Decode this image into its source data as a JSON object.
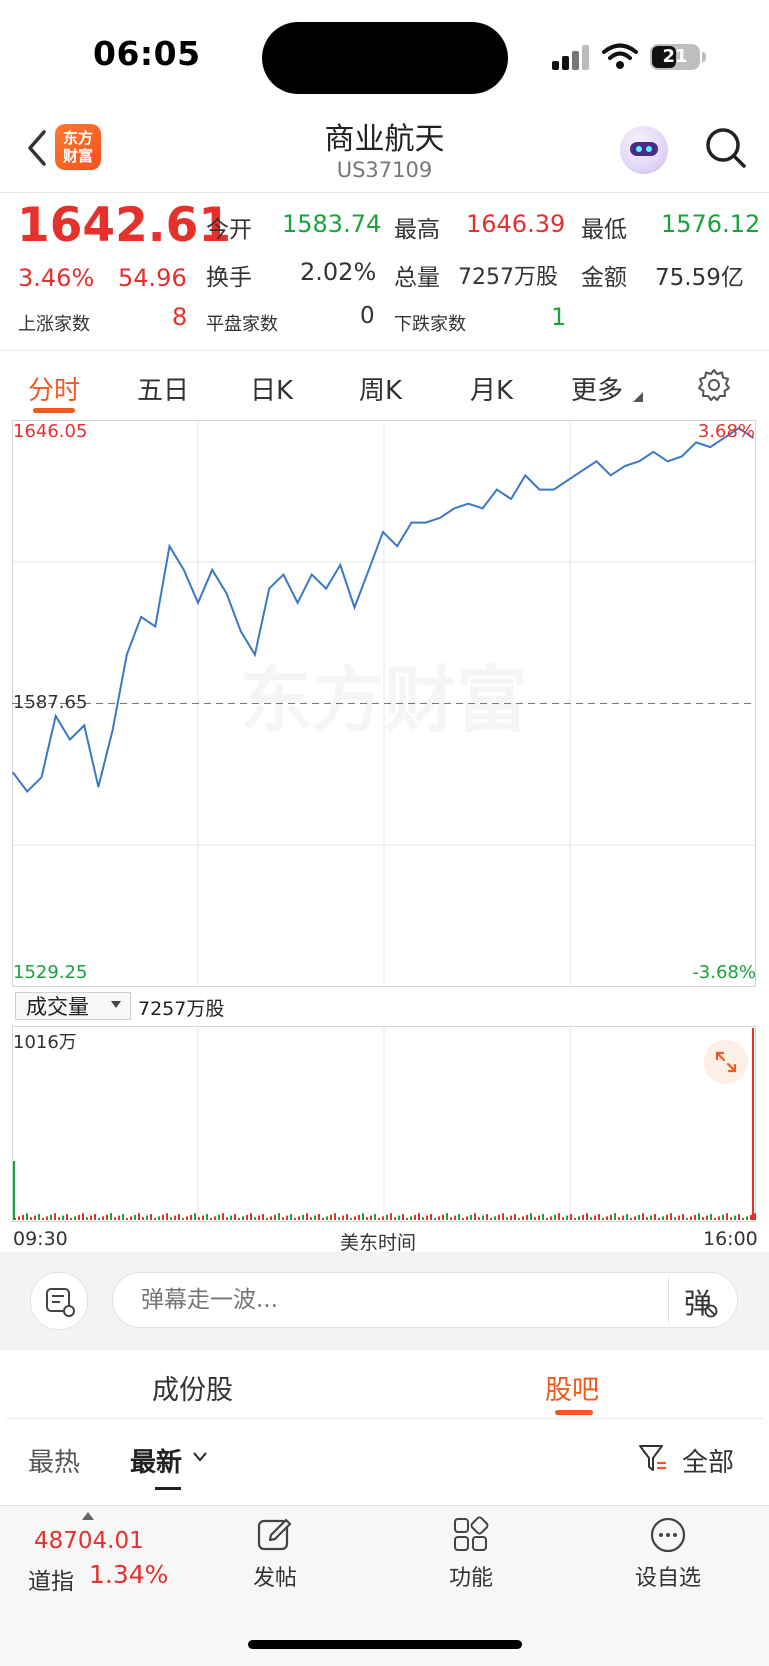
{
  "status_bar": {
    "time": "06:05",
    "battery": "21"
  },
  "header": {
    "logo_line1": "东方",
    "logo_line2": "财富",
    "title": "商业航天",
    "code": "US37109"
  },
  "quote": {
    "price": "1642.61",
    "change_pct": "3.46%",
    "change": "54.96",
    "open_label": "今开",
    "open": "1583.74",
    "high_label": "最高",
    "high": "1646.39",
    "low_label": "最低",
    "low": "1576.12",
    "turnover_label": "换手",
    "turnover": "2.02%",
    "volume_label": "总量",
    "volume": "7257万股",
    "amount_label": "金额",
    "amount": "75.59亿",
    "up_label": "上涨家数",
    "up_count": "8",
    "flat_label": "平盘家数",
    "flat_count": "0",
    "down_label": "下跌家数",
    "down_count": "1"
  },
  "tabs": [
    "分时",
    "五日",
    "日K",
    "周K",
    "月K",
    "更多"
  ],
  "chart": {
    "top_price": "1646.05",
    "top_pct": "3.68%",
    "mid_price": "1587.65",
    "bottom_price": "1529.25",
    "bottom_pct": "-3.68%",
    "watermark": "东方财富",
    "volume_select": "成交量",
    "volume_total": "7257万股",
    "volume_max": "1016万",
    "time_start": "09:30",
    "time_mid": "美东时间",
    "time_end": "16:00"
  },
  "chart_data": {
    "type": "line",
    "ylim": [
      1529.25,
      1646.05
    ],
    "reference": 1587.65,
    "x": [
      "09:30",
      "16:00"
    ],
    "series": [
      {
        "values": [
          1573,
          1569,
          1572,
          1585,
          1580,
          1583,
          1570,
          1582,
          1598,
          1606,
          1604,
          1621,
          1616,
          1609,
          1616,
          1611,
          1603,
          1598,
          1612,
          1615,
          1609,
          1615,
          1612,
          1617,
          1608,
          1616,
          1624,
          1621,
          1626,
          1626,
          1627,
          1629,
          1630,
          1629,
          1633,
          1631,
          1636,
          1633,
          1633,
          1635,
          1637,
          1639,
          1636,
          1638,
          1639,
          1641,
          1639,
          1640,
          1643,
          1642,
          1644,
          1646,
          1644
        ]
      }
    ]
  },
  "danmu": {
    "placeholder": "弹幕走一波...",
    "button": "弹"
  },
  "sub_tabs": [
    "成份股",
    "股吧"
  ],
  "filters": {
    "hot": "最热",
    "new": "最新",
    "all": "全部"
  },
  "bottom_nav": {
    "index_value": "48704.01",
    "index_name": "道指",
    "index_pct": "1.34%",
    "post": "发帖",
    "function": "功能",
    "watchlist": "设自选"
  }
}
